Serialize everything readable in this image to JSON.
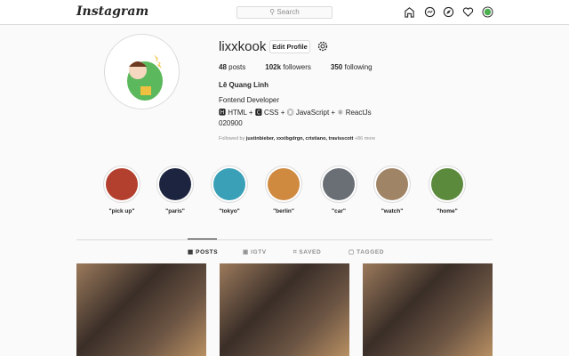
{
  "header": {
    "logo": "Instagram",
    "search_placeholder": "Search",
    "nav_icons": [
      "home-icon",
      "messenger-icon",
      "explore-icon",
      "heart-icon",
      "avatar-icon"
    ]
  },
  "profile": {
    "username": "lixxkook",
    "edit_label": "Edit Profile",
    "posts": "48",
    "posts_label": "posts",
    "followers": "102k",
    "followers_label": "followers",
    "following": "350",
    "following_label": "following",
    "full_name": "Lê Quang Linh",
    "bio": [
      "Fontend Developer",
      "🅷 HTML + 🅲 CSS + ◎ JavaScript + ⚛ ReactJs",
      "020900"
    ],
    "followed_by_prefix": "Followed by",
    "followed_by": "justinbieber, xxxibgdrgn, cristiano, travisscott",
    "followed_more": "+86 more"
  },
  "stories": [
    {
      "label": "\"pick up\"",
      "color": "#b3402f"
    },
    {
      "label": "\"paris\"",
      "color": "#1d2440"
    },
    {
      "label": "\"tokyo\"",
      "color": "#3aa0b8"
    },
    {
      "label": "\"berlin\"",
      "color": "#d08a40"
    },
    {
      "label": "\"car\"",
      "color": "#6a6e75"
    },
    {
      "label": "\"watch\"",
      "color": "#a08466"
    },
    {
      "label": "\"home\"",
      "color": "#5c8a3c"
    }
  ],
  "tabs": [
    {
      "label": "POSTS",
      "icon": "grid-icon",
      "active": true
    },
    {
      "label": "IGTV",
      "icon": "igtv-icon"
    },
    {
      "label": "SAVED",
      "icon": "bookmark-icon"
    },
    {
      "label": "TAGGED",
      "icon": "tag-icon"
    }
  ]
}
